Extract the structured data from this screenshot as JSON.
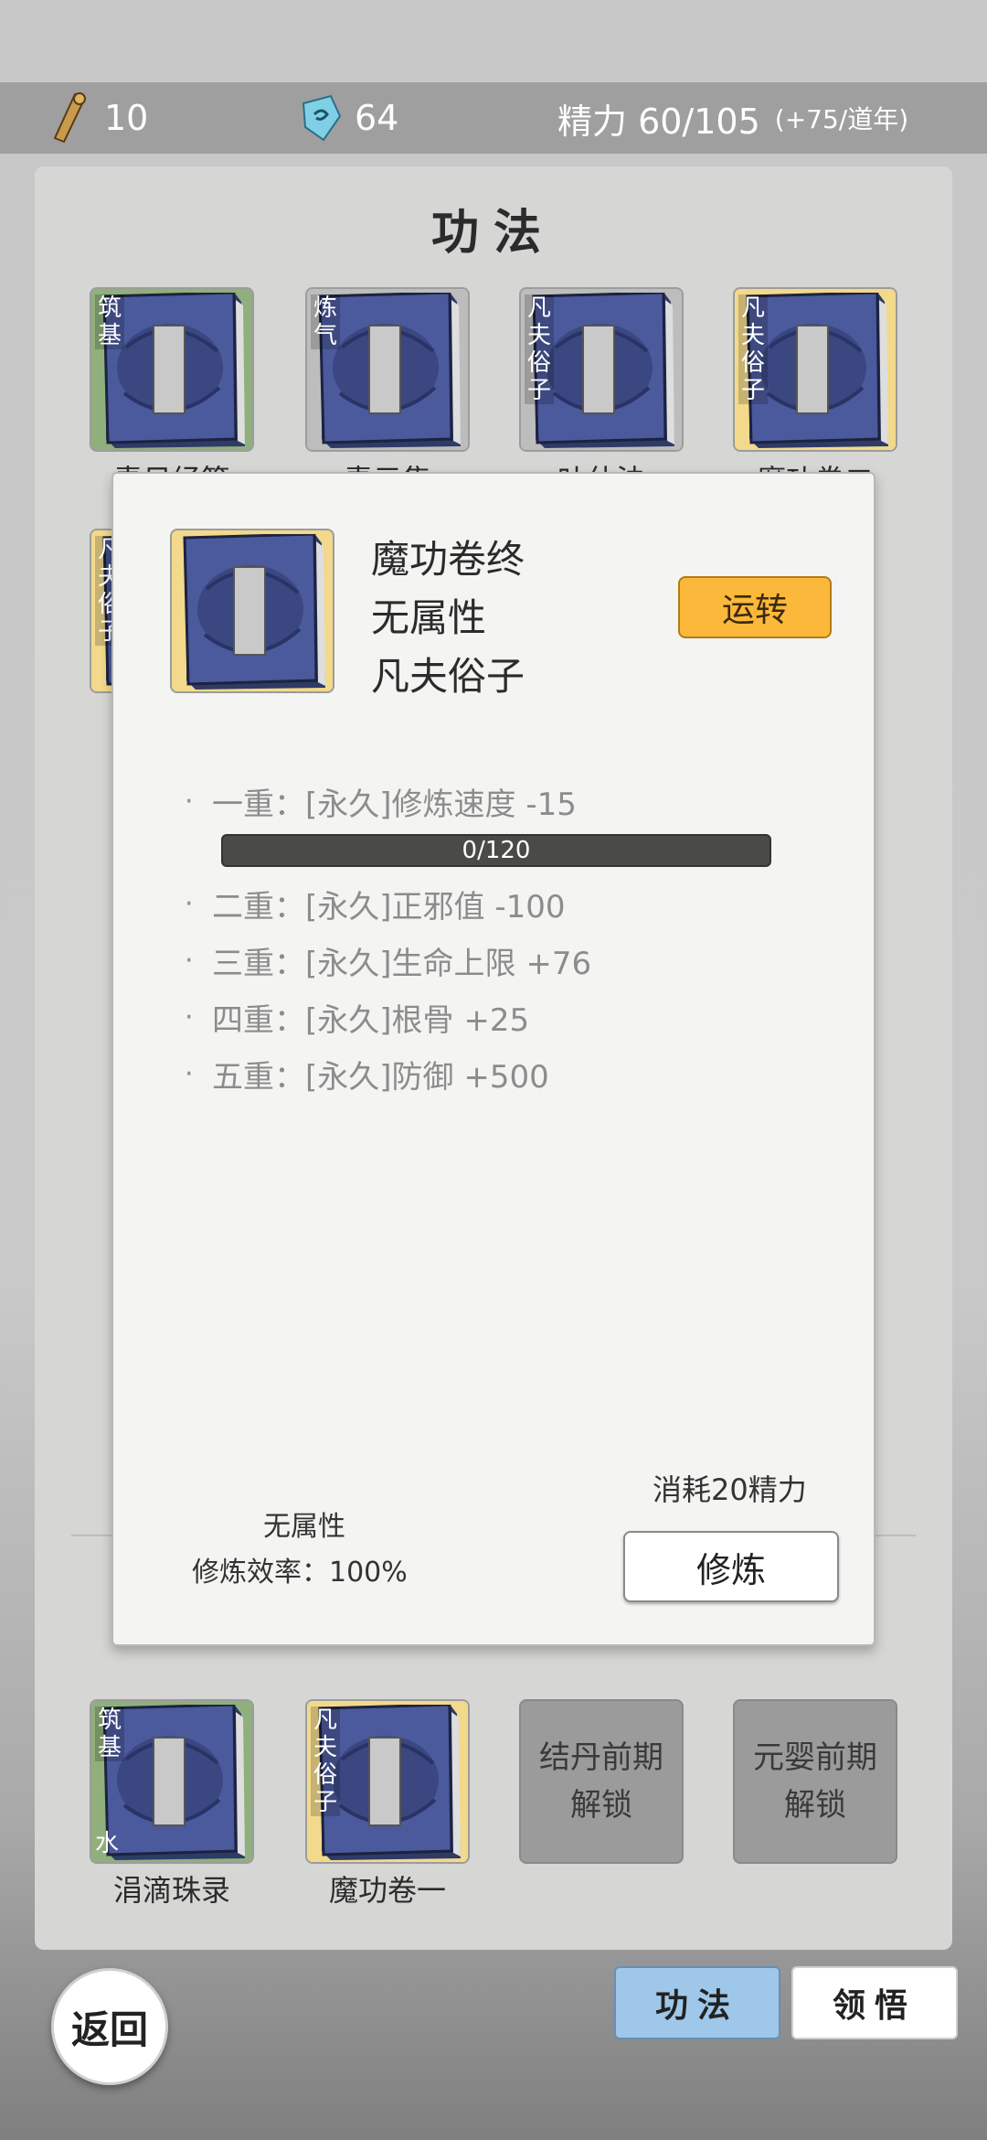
{
  "resources": {
    "scroll_count": "10",
    "crystal_count": "64",
    "energy_label": "精力 60/105",
    "energy_rate": "(+75/道年)"
  },
  "panel": {
    "title": "功法",
    "top_books": [
      {
        "tag": "筑基",
        "name": "青日经篇",
        "bg": "#8fb07c"
      },
      {
        "tag": "炼气",
        "name": "青元集",
        "bg": "#bdbdbd"
      },
      {
        "tag": "凡夫俗子",
        "name": "叶什法",
        "bg": "#bdbdbd"
      },
      {
        "tag": "凡夫俗子",
        "name": "魔功卷二",
        "bg": "#f2d98b"
      }
    ],
    "left_partial_book": {
      "tag": "凡夫俗子",
      "bg": "#f2d98b"
    },
    "bottom_books": [
      {
        "tag": "筑基",
        "element": "水",
        "name": "涓滴珠录",
        "bg": "#8fb07c"
      },
      {
        "tag": "凡夫俗子",
        "name": "魔功卷一",
        "bg": "#f2d98b"
      }
    ],
    "locked_slots": [
      {
        "line1": "结丹前期",
        "line2": "解锁"
      },
      {
        "line1": "元婴前期",
        "line2": "解锁"
      }
    ]
  },
  "modal": {
    "book_name": "魔功卷终",
    "attribute": "无属性",
    "rank": "凡夫俗子",
    "run_button": "运转",
    "effects": [
      {
        "level": "一重：",
        "text": "[永久]修炼速度 -15"
      },
      {
        "level": "二重：",
        "text": "[永久]正邪值 -100"
      },
      {
        "level": "三重：",
        "text": "[永久]生命上限 +76"
      },
      {
        "level": "四重：",
        "text": "[永久]根骨 +25"
      },
      {
        "level": "五重：",
        "text": "[永久]防御 +500"
      }
    ],
    "progress_text": "0/120",
    "progress_fraction": 0,
    "footer_attribute": "无属性",
    "efficiency": "修炼效率：100%",
    "cost": "消耗20精力",
    "practice_button": "修炼"
  },
  "bottom": {
    "back_button": "返回",
    "tab_active": "功法",
    "tab_other": "领悟"
  },
  "colors": {
    "book_blue": "#3f4f8f",
    "run_button": "#fbb83a",
    "active_tab": "#9ec7ea"
  }
}
